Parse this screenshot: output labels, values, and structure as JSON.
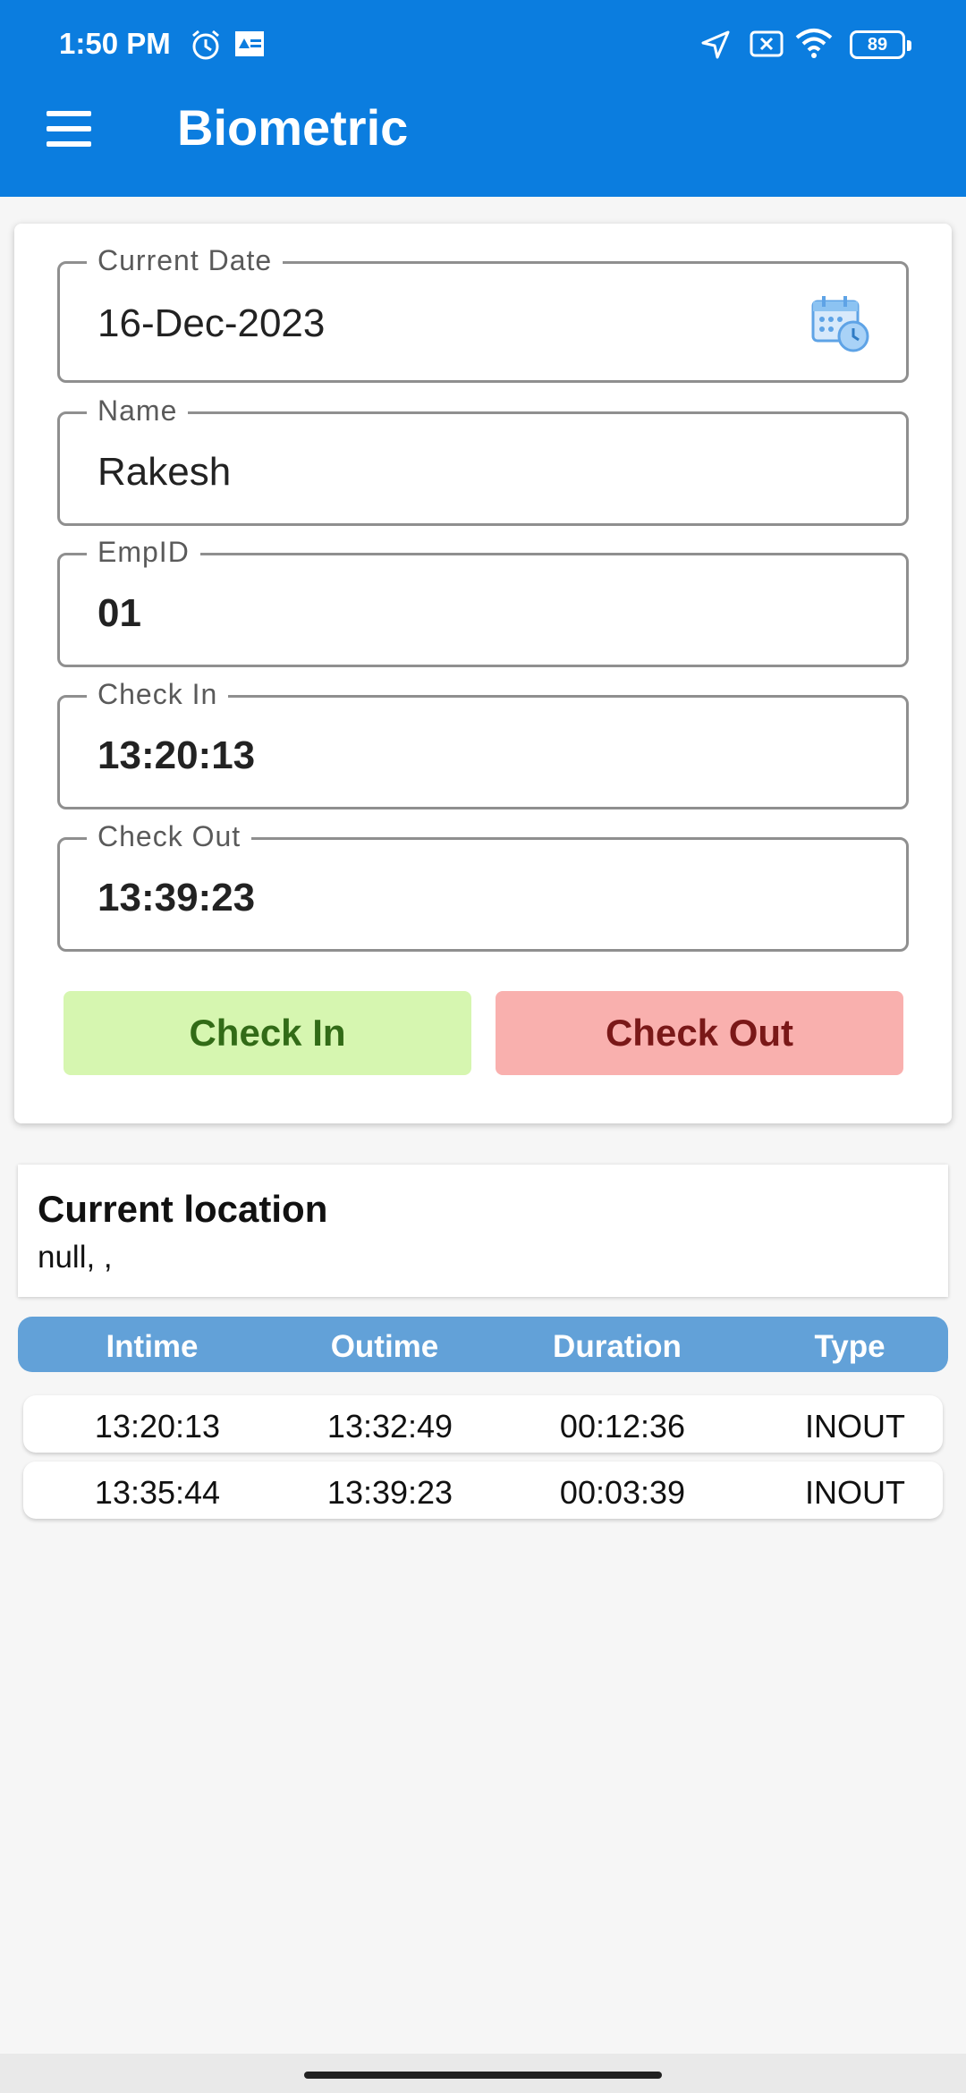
{
  "status_bar": {
    "time": "1:50 PM",
    "battery": "89",
    "icons": [
      "alarm-icon",
      "app-notification-icon",
      "location-arrow-icon",
      "sim-off-icon",
      "wifi-icon",
      "battery-icon"
    ]
  },
  "app_bar": {
    "title": "Biometric",
    "menu_icon": "hamburger-menu-icon"
  },
  "form": {
    "current_date": {
      "label": "Current Date",
      "value": "16-Dec-2023",
      "icon": "calendar-clock-icon"
    },
    "name": {
      "label": "Name",
      "value": "Rakesh"
    },
    "emp_id": {
      "label": "EmpID",
      "value": "01"
    },
    "check_in": {
      "label": "Check In",
      "value": "13:20:13"
    },
    "check_out": {
      "label": "Check Out",
      "value": "13:39:23"
    },
    "check_in_button": "Check In",
    "check_out_button": "Check Out"
  },
  "location": {
    "title": "Current location",
    "value": "null, ,"
  },
  "table": {
    "headers": [
      "Intime",
      "Outime",
      "Duration",
      "Type"
    ],
    "rows": [
      [
        "13:20:13",
        "13:32:49",
        "00:12:36",
        "INOUT"
      ],
      [
        "13:35:44",
        "13:39:23",
        "00:03:39",
        "INOUT"
      ]
    ]
  },
  "colors": {
    "app_bar": "#0b7ddf",
    "check_in_bg": "#d6f6b0",
    "check_out_bg": "#f9b0ae",
    "table_header": "#62a1d8"
  }
}
